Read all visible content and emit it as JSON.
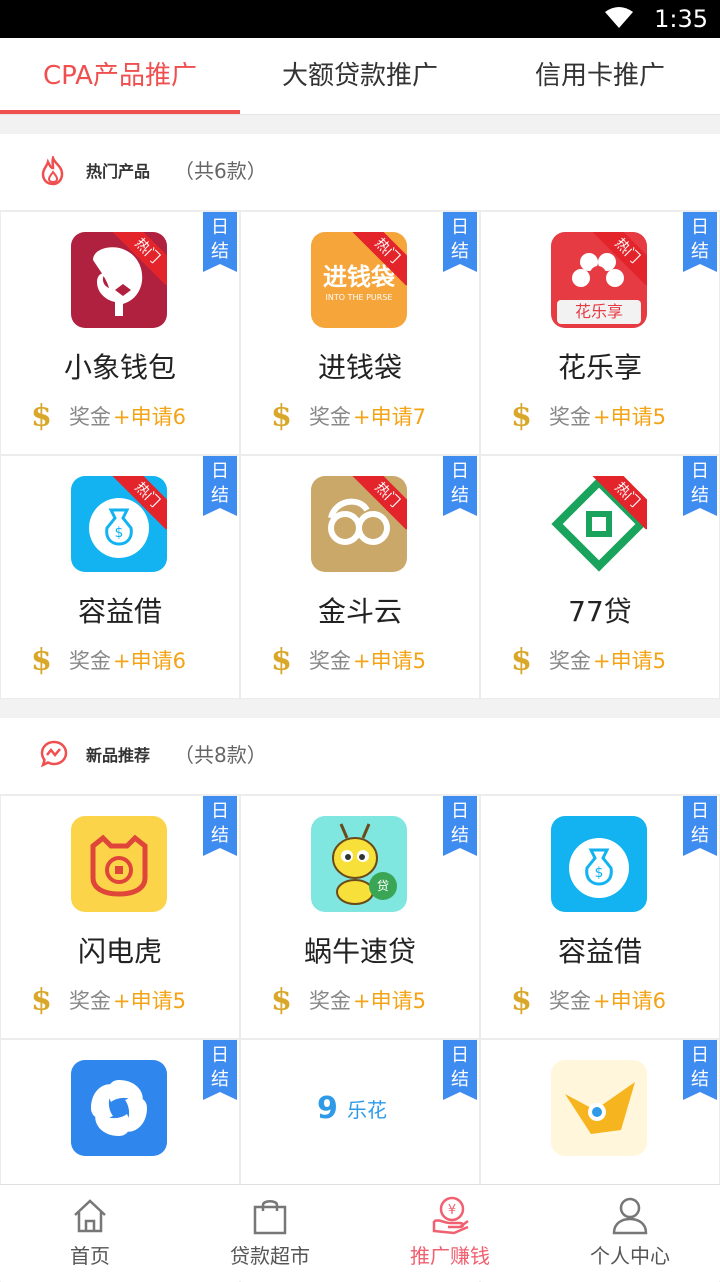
{
  "status_bar": {
    "time": "1:35",
    "icons": [
      "wifi-icon"
    ]
  },
  "tabs": [
    {
      "label": "CPA产品推广",
      "active": true
    },
    {
      "label": "大额贷款推广",
      "active": false
    },
    {
      "label": "信用卡推广",
      "active": false
    }
  ],
  "colors": {
    "accent": "#ef4f4f",
    "ribbon": "#3f8cf0",
    "reward": "#f3a316",
    "coin": "#d9a72a",
    "hot": "#e3242b"
  },
  "sections": [
    {
      "title": "热门产品",
      "count": "（共6款）",
      "icon": "flame-icon",
      "products": [
        {
          "name": "小象钱包",
          "badge": "日结",
          "reward_label": "奖金",
          "reward_value": "+申请6",
          "logo": "elephant-logo",
          "hot": true,
          "hot_label": "热门"
        },
        {
          "name": "进钱袋",
          "badge": "日结",
          "reward_label": "奖金",
          "reward_value": "+申请7",
          "logo": "jinqiandai-logo",
          "hot": true,
          "hot_label": "热门",
          "logo_text": "进钱袋",
          "logo_subtext": "INTO THE PURSE"
        },
        {
          "name": "花乐享",
          "badge": "日结",
          "reward_label": "奖金",
          "reward_value": "+申请5",
          "logo": "hualexiang-logo",
          "hot": true,
          "hot_label": "热门",
          "logo_text": "花乐享"
        },
        {
          "name": "容益借",
          "badge": "日结",
          "reward_label": "奖金",
          "reward_value": "+申请6",
          "logo": "money-bag-logo",
          "hot": true,
          "hot_label": "热门"
        },
        {
          "name": "金斗云",
          "badge": "日结",
          "reward_label": "奖金",
          "reward_value": "+申请5",
          "logo": "jindouyun-logo",
          "hot": true,
          "hot_label": "热门"
        },
        {
          "name": "77贷",
          "badge": "日结",
          "reward_label": "奖金",
          "reward_value": "+申请5",
          "logo": "77dai-logo",
          "hot": true,
          "hot_label": "热门"
        }
      ]
    },
    {
      "title": "新品推荐",
      "count": "（共8款）",
      "icon": "chat-trend-icon",
      "products": [
        {
          "name": "闪电虎",
          "badge": "日结",
          "reward_label": "奖金",
          "reward_value": "+申请5",
          "logo": "tiger-logo",
          "hot": false
        },
        {
          "name": "蜗牛速贷",
          "badge": "日结",
          "reward_label": "奖金",
          "reward_value": "+申请5",
          "logo": "snail-logo",
          "hot": false,
          "logo_text": "贷"
        },
        {
          "name": "容益借",
          "badge": "日结",
          "reward_label": "奖金",
          "reward_value": "+申请6",
          "logo": "money-bag-logo",
          "hot": false
        },
        {
          "name": "",
          "badge": "日结",
          "reward_label": "",
          "reward_value": "",
          "logo": "swirl-logo",
          "hot": false
        },
        {
          "name": "",
          "badge": "日结",
          "reward_label": "",
          "reward_value": "",
          "logo": "lehua-logo",
          "hot": false,
          "logo_text": "乐花"
        },
        {
          "name": "",
          "badge": "日结",
          "reward_label": "",
          "reward_value": "",
          "logo": "bird-logo",
          "hot": false
        }
      ]
    }
  ],
  "bottom_nav": [
    {
      "label": "首页",
      "icon": "home-icon",
      "active": false
    },
    {
      "label": "贷款超市",
      "icon": "shopping-bag-icon",
      "active": false
    },
    {
      "label": "推广赚钱",
      "icon": "promote-money-icon",
      "active": true
    },
    {
      "label": "个人中心",
      "icon": "user-icon",
      "active": false
    }
  ]
}
